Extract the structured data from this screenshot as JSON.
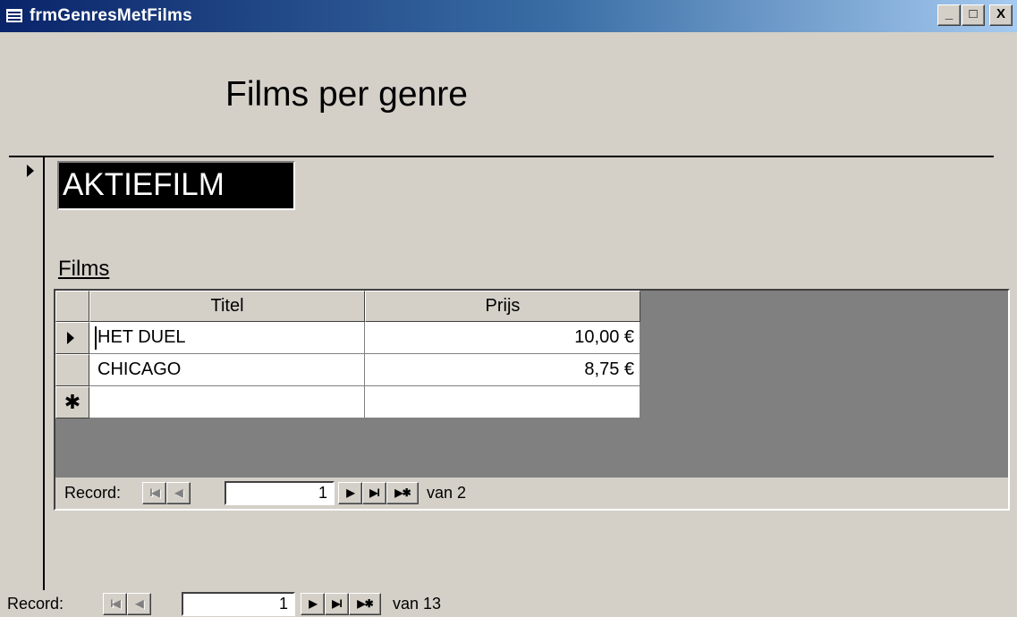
{
  "window": {
    "title": "frmGenresMetFilms",
    "controls": {
      "minimize": "_",
      "maximize": "□",
      "close": "X"
    }
  },
  "form": {
    "title": "Films per genre",
    "genre_value": "AKTIEFILM",
    "subform_label": "Films"
  },
  "subform": {
    "columns": [
      "Titel",
      "Prijs"
    ],
    "rows": [
      {
        "titel": "HET DUEL",
        "prijs": "10,00 €"
      },
      {
        "titel": "CHICAGO",
        "prijs": "8,75 €"
      }
    ],
    "new_row_marker": "✱",
    "nav": {
      "label": "Record:",
      "current": "1",
      "of_text": "van 2"
    }
  },
  "main_nav": {
    "label": "Record:",
    "current": "1",
    "of_text": "van 13"
  },
  "icons": {
    "first": "I◀",
    "prev": "◀",
    "next": "▶",
    "last": "▶I",
    "new": "▶✱"
  }
}
